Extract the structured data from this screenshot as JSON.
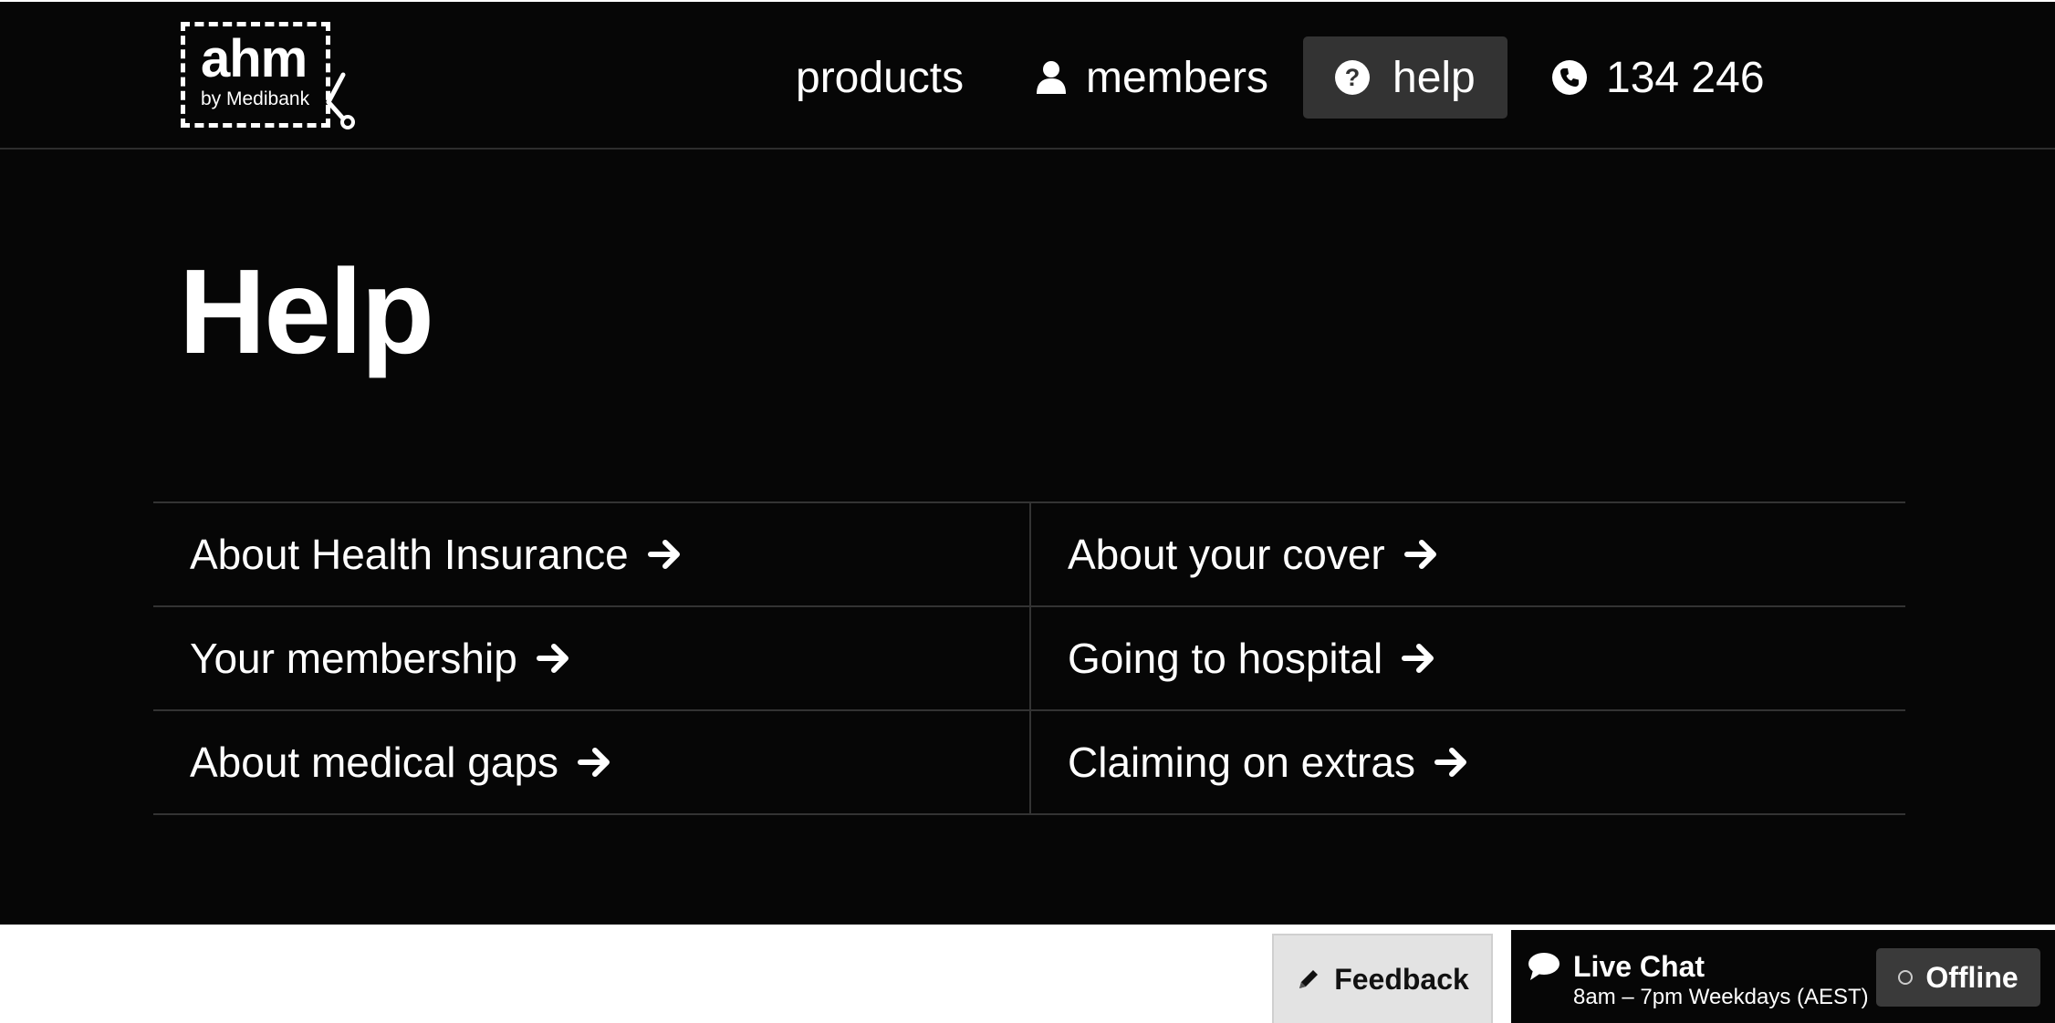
{
  "header": {
    "logo": {
      "brand": "ahm",
      "tagline": "by Medibank"
    },
    "nav": {
      "products": "products",
      "members": "members",
      "help": "help",
      "phone": "134 246"
    }
  },
  "main": {
    "title": "Help",
    "links": [
      {
        "label": "About Health Insurance"
      },
      {
        "label": "About your cover"
      },
      {
        "label": "Your membership"
      },
      {
        "label": "Going to hospital"
      },
      {
        "label": "About medical gaps"
      },
      {
        "label": "Claiming on extras"
      }
    ]
  },
  "widgets": {
    "feedback_label": "Feedback",
    "live_chat": {
      "title": "Live Chat",
      "hours": "8am – 7pm Weekdays (AEST)",
      "status": "Offline"
    }
  },
  "icons": {
    "members": "user-icon",
    "help": "question-circle-icon",
    "phone": "phone-icon",
    "link_arrow": "arrow-right-icon",
    "feedback": "pencil-icon",
    "chat": "chat-bubble-icon",
    "status": "status-dot-icon"
  },
  "colors": {
    "background": "#060606",
    "active_nav": "#333333",
    "divider": "#333333",
    "feedback_bg": "#e3e3e3",
    "offline_bg": "#3a3a3a"
  }
}
